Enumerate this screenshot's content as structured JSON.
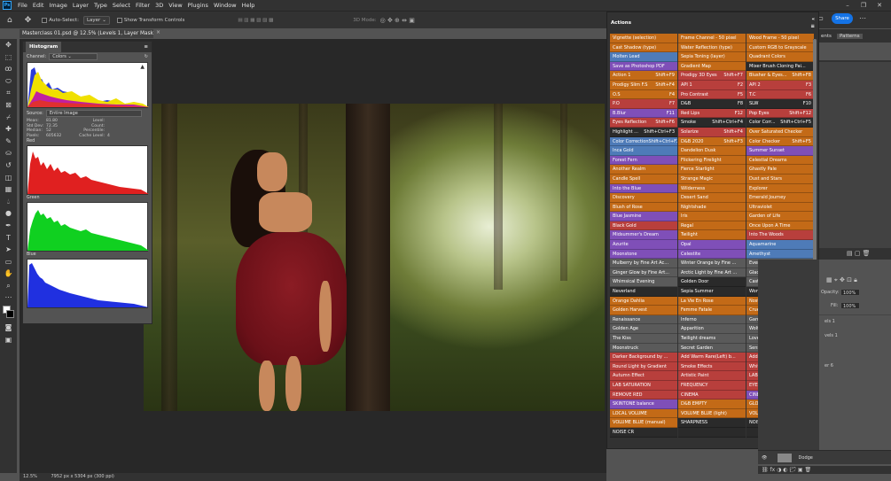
{
  "menubar": {
    "items": [
      "File",
      "Edit",
      "Image",
      "Layer",
      "Type",
      "Select",
      "Filter",
      "3D",
      "View",
      "Plugins",
      "Window",
      "Help"
    ],
    "logo": "Ps"
  },
  "options": {
    "auto_select_label": "Auto-Select:",
    "auto_select_value": "Layer",
    "transform_label": "Show Transform Controls",
    "mode_label": "3D Mode:",
    "share_label": "Share"
  },
  "document": {
    "tab_title": "Masterclass 01.psd @ 12.5% (Levels 1, Layer Mask/8)",
    "zoom": "12.5%",
    "dimensions": "7952 px x 5304 px (300 ppi)"
  },
  "histogram": {
    "tab_label": "Histogram",
    "channel_label": "Channel:",
    "channel_value": "Colors",
    "source_label": "Source:",
    "source_value": "Entire Image",
    "stats": {
      "mean_label": "Mean:",
      "mean": "81.80",
      "stddev_label": "Std Dev:",
      "stddev": "72.35",
      "median_label": "Median:",
      "median": "52",
      "pixels_label": "Pixels:",
      "pixels": "605632",
      "level_label": "Level:",
      "count_label": "Count:",
      "percentile_label": "Percentile:",
      "cache_label": "Cache Level:",
      "cache": "4"
    },
    "channels": [
      "Red",
      "Green",
      "Blue"
    ]
  },
  "actions_panel": {
    "title": "Actions",
    "columns": [
      [
        {
          "label": "Vignette (selection)",
          "color": "orange"
        },
        {
          "label": "Cast Shadow (type)",
          "color": "orange"
        },
        {
          "label": "Molten Lead",
          "color": "blue"
        },
        {
          "label": "Save as Photoshop PDF",
          "color": "violet"
        },
        {
          "label": "Action 1",
          "key": "Shift+F9",
          "color": "orange"
        },
        {
          "label": "Prodigy Slim F.S",
          "key": "Shift+F4",
          "color": "orange"
        },
        {
          "label": "O.S",
          "key": "F4",
          "color": "orange"
        },
        {
          "label": "P.O",
          "key": "F7",
          "color": "red"
        },
        {
          "label": "B.Blur",
          "key": "F11",
          "color": "violet"
        },
        {
          "label": "Eyes Reflection",
          "key": "Shift+F6",
          "color": "red"
        },
        {
          "label": "Highlight ...",
          "key": "Shift+Ctrl+F3",
          "color": "none"
        },
        {
          "label": "Color Correction",
          "key": "Shift+Ctrl+F2",
          "color": "blue"
        },
        {
          "label": "Inca Gold",
          "color": "blue"
        },
        {
          "label": "Forest Fern",
          "color": "violet"
        },
        {
          "label": "Another Realm",
          "color": "orange"
        },
        {
          "label": "Candle Spell",
          "color": "orange"
        },
        {
          "label": "Into the Blue",
          "color": "violet"
        },
        {
          "label": "Discovery",
          "color": "orange"
        },
        {
          "label": "Blush of Rose",
          "color": "orange"
        },
        {
          "label": "Blue Jasmine",
          "color": "violet"
        },
        {
          "label": "Black Gold",
          "color": "red"
        },
        {
          "label": "Midsummer's Dream",
          "color": "violet"
        },
        {
          "label": "Azurite",
          "color": "violet"
        },
        {
          "label": "Moonstone",
          "color": "violet"
        },
        {
          "label": "Mulberry by Fine Art Ac...",
          "color": "gray"
        },
        {
          "label": "Ginger Glow by Fine Art...",
          "color": "gray"
        },
        {
          "label": "Whimsical Evening",
          "color": "gray"
        },
        {
          "label": "Neverland",
          "color": "none"
        },
        {
          "label": "Orange Dahlia",
          "color": "orange"
        },
        {
          "label": "Golden Harvest",
          "color": "orange"
        },
        {
          "label": "Renaissance",
          "color": "gray"
        },
        {
          "label": "Golden Age",
          "color": "gray"
        },
        {
          "label": "The Kiss",
          "color": "gray"
        },
        {
          "label": "Moonstruck",
          "color": "gray"
        },
        {
          "label": "Darker Background by ...",
          "color": "red"
        },
        {
          "label": "Round Light by Gradient",
          "color": "red"
        },
        {
          "label": "Autumn Effect",
          "color": "red"
        },
        {
          "label": "LAB SATURATION",
          "color": "red"
        },
        {
          "label": "REMOVE RED",
          "color": "red"
        },
        {
          "label": "SKINTONE balance",
          "color": "violet"
        },
        {
          "label": "LOCAL VOLUME",
          "color": "orange"
        },
        {
          "label": "VOLUME BLUE (manual)",
          "color": "orange"
        },
        {
          "label": "NOISE CR",
          "color": "none"
        }
      ],
      [
        {
          "label": "Frame Channel - 50 pixel",
          "color": "orange"
        },
        {
          "label": "Water Reflection (type)",
          "color": "orange"
        },
        {
          "label": "Sepia Toning (layer)",
          "color": "orange"
        },
        {
          "label": "Gradient Map",
          "color": "orange"
        },
        {
          "label": "Prodigy 3D Eyes",
          "key": "Shift+F7",
          "color": "red"
        },
        {
          "label": "API 1",
          "key": "F2",
          "color": "red"
        },
        {
          "label": "Pro Contrast",
          "key": "F5",
          "color": "red"
        },
        {
          "label": "D&B",
          "key": "F8",
          "color": "none"
        },
        {
          "label": "Red Lips",
          "key": "F12",
          "color": "red"
        },
        {
          "label": "Smoke",
          "key": "Shift+Ctrl+F4",
          "color": "none"
        },
        {
          "label": "Solarize",
          "key": "Shift+F4",
          "color": "red"
        },
        {
          "label": "D&B 2020",
          "key": "Shift+F3",
          "color": "orange"
        },
        {
          "label": "Dandelion Dusk",
          "color": "orange"
        },
        {
          "label": "Flickering Firelight",
          "color": "orange"
        },
        {
          "label": "Fierce Starlight",
          "color": "orange"
        },
        {
          "label": "Strange Magic",
          "color": "orange"
        },
        {
          "label": "Wilderness",
          "color": "orange"
        },
        {
          "label": "Desert Sand",
          "color": "orange"
        },
        {
          "label": "Nightshade",
          "color": "orange"
        },
        {
          "label": "Iris",
          "color": "orange"
        },
        {
          "label": "Regal",
          "color": "orange"
        },
        {
          "label": "Twilight",
          "color": "orange"
        },
        {
          "label": "Opal",
          "color": "violet"
        },
        {
          "label": "Celestite",
          "color": "violet"
        },
        {
          "label": "Winter Orange by Fine ...",
          "color": "gray"
        },
        {
          "label": "Arctic Light by Fine Art ...",
          "color": "gray"
        },
        {
          "label": "Golden Door",
          "color": "none"
        },
        {
          "label": "Sepia Summer",
          "color": "none"
        },
        {
          "label": "La Vie En Rose",
          "color": "orange"
        },
        {
          "label": "Femme Fatale",
          "color": "orange"
        },
        {
          "label": "Inferno",
          "color": "gray"
        },
        {
          "label": "Apparition",
          "color": "gray"
        },
        {
          "label": "Twilight dreams",
          "color": "gray"
        },
        {
          "label": "Secret Garden",
          "color": "gray"
        },
        {
          "label": "Add Warm Rare(Left) b...",
          "color": "red"
        },
        {
          "label": "Smoke Effects",
          "color": "red"
        },
        {
          "label": "Artistic Paint",
          "color": "red"
        },
        {
          "label": "FREQUENCY",
          "color": "red"
        },
        {
          "label": "CINEMA",
          "color": "red"
        },
        {
          "label": "D&B EMPTY",
          "color": "orange"
        },
        {
          "label": "VOLUME BLUE (light)",
          "color": "orange"
        },
        {
          "label": "SHARPNESS",
          "color": "none"
        },
        {
          "label": "",
          "color": "none"
        }
      ],
      [
        {
          "label": "Wood Frame - 50 pixel",
          "color": "orange"
        },
        {
          "label": "Custom RGB to Grayscale",
          "color": "orange"
        },
        {
          "label": "Quadrant Colors",
          "color": "orange"
        },
        {
          "label": "Mixer Brush Cloning Pai...",
          "color": "none"
        },
        {
          "label": "Blusher & Eyes...",
          "key": "Shift+F8",
          "color": "orange"
        },
        {
          "label": "API 2",
          "key": "F3",
          "color": "red"
        },
        {
          "label": "T.C",
          "key": "F6",
          "color": "red"
        },
        {
          "label": "SLW",
          "key": "F10",
          "color": "none"
        },
        {
          "label": "Pop Eyes",
          "key": "Shift+F12",
          "color": "red"
        },
        {
          "label": "Color Corr...",
          "key": "Shift+Ctrl+F5",
          "color": "none"
        },
        {
          "label": "Over Saturated Checker",
          "color": "orange"
        },
        {
          "label": "Color Checker",
          "key": "Shift+F5",
          "color": "orange"
        },
        {
          "label": "Summer Sunset",
          "color": "violet"
        },
        {
          "label": "Celestial Dreams",
          "color": "orange"
        },
        {
          "label": "Ghastly Pale",
          "color": "orange"
        },
        {
          "label": "Dust and Stars",
          "color": "orange"
        },
        {
          "label": "Explorer",
          "color": "orange"
        },
        {
          "label": "Emerald Journey",
          "color": "orange"
        },
        {
          "label": "Ultraviolet",
          "color": "orange"
        },
        {
          "label": "Garden of Life",
          "color": "orange"
        },
        {
          "label": "Once Upon A Time",
          "color": "orange"
        },
        {
          "label": "Into The Woods",
          "color": "red"
        },
        {
          "label": "Aquamarine",
          "color": "blue"
        },
        {
          "label": "Amethyst",
          "color": "blue"
        },
        {
          "label": "Evergreen by Fine Art A...",
          "color": "gray"
        },
        {
          "label": "Glacial Frost by Fine Art...",
          "color": "gray"
        },
        {
          "label": "Castle Stones",
          "color": "gray"
        },
        {
          "label": "Wonderland",
          "color": "none"
        },
        {
          "label": "Nostalgia",
          "color": "orange"
        },
        {
          "label": "Cruella",
          "color": "orange"
        },
        {
          "label": "Garden of Paradise",
          "color": "gray"
        },
        {
          "label": "Wolf in the Woods",
          "color": "gray"
        },
        {
          "label": "Lovers in the springtime",
          "color": "gray"
        },
        {
          "label": "Sense and Sensuality",
          "color": "gray"
        },
        {
          "label": "Add Warm Rare(Right) ...",
          "color": "red"
        },
        {
          "label": "White Tone Effect",
          "color": "red"
        },
        {
          "label": "LAB convert",
          "color": "red"
        },
        {
          "label": "EYES",
          "color": "red"
        },
        {
          "label": "CINEMA v2",
          "color": "violet"
        },
        {
          "label": "GLOBAL VOLUME",
          "color": "orange"
        },
        {
          "label": "VOLUME BLUE (medium)",
          "color": "orange"
        },
        {
          "label": "NOISE texture",
          "color": "none"
        },
        {
          "label": "",
          "color": "none"
        }
      ]
    ]
  },
  "right_dock": {
    "tabs": [
      "ents",
      "Patterns"
    ],
    "opacity_label": "Opacity:",
    "opacity": "100%",
    "fill_label": "Fill:",
    "fill": "100%",
    "layer_names": [
      "els 1",
      "vels 1",
      "er 6"
    ],
    "dodge_layer": "Dodge"
  },
  "colors": {
    "accent": "#1473e6",
    "orange": "#c36a17",
    "red": "#b83f3c",
    "violet": "#7f4fb8",
    "blue": "#4e7bb8",
    "gray": "#5a5a5a"
  }
}
